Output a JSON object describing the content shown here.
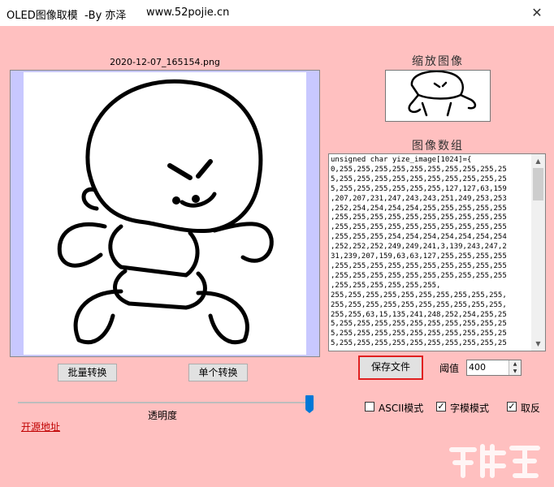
{
  "window": {
    "title": "OLED图像取模  -By 亦泽",
    "url": "www.52pojie.cn",
    "close_icon": "close-icon"
  },
  "preview": {
    "filename": "2020-12-07_165154.png"
  },
  "buttons": {
    "batch_convert": "批量转换",
    "single_convert": "单个转换",
    "save_file": "保存文件"
  },
  "slider": {
    "label": "透明度",
    "value": 1.0
  },
  "source_link": "开源地址",
  "thumbnail": {
    "title": "缩放图像"
  },
  "array": {
    "title": "图像数组",
    "text": "unsigned char yize_image[1024]={\n0,255,255,255,255,255,255,255,255,255,25\n5,255,255,255,255,255,255,255,255,255,25\n5,255,255,255,255,255,255,127,127,63,159\n,207,207,231,247,243,243,251,249,253,253\n,252,254,254,254,254,255,255,255,255,255\n,255,255,255,255,255,255,255,255,255,255\n,255,255,255,255,255,255,255,255,255,255\n,255,255,255,254,254,254,254,254,254,254\n,252,252,252,249,249,241,3,139,243,247,2\n31,239,207,159,63,63,127,255,255,255,255\n,255,255,255,255,255,255,255,255,255,255\n,255,255,255,255,255,255,255,255,255,255\n,255,255,255,255,255,255,\n255,255,255,255,255,255,255,255,255,255,\n255,255,255,255,255,255,255,255,255,255,\n255,255,63,15,135,241,248,252,254,255,25\n5,255,255,255,255,255,255,255,255,255,25\n5,255,255,255,255,255,255,255,255,255,25\n5,255,255,255,255,255,255,255,255,255,25"
  },
  "threshold": {
    "label": "阈值",
    "value": "400"
  },
  "options": {
    "ascii_mode": {
      "label": "ASCII模式",
      "checked": false
    },
    "font_mode": {
      "label": "字模模式",
      "checked": true
    },
    "invert": {
      "label": "取反",
      "checked": true
    }
  }
}
